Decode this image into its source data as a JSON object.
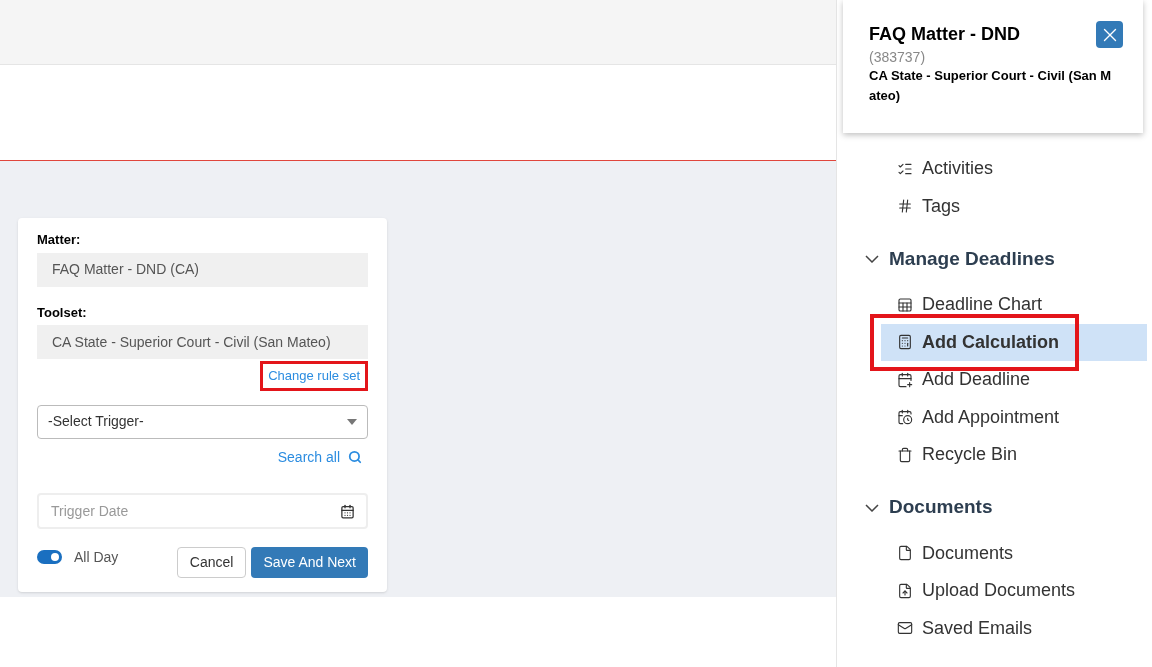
{
  "form": {
    "matter": {
      "label": "Matter:",
      "value": "FAQ Matter - DND (CA)"
    },
    "toolset": {
      "label": "Toolset:",
      "value": "CA State - Superior Court - Civil (San Mateo)"
    },
    "change_link": {
      "label": "Change rule set",
      "annotated": true
    },
    "trigger_select": {
      "placeholder": "-Select Trigger-"
    },
    "search_all": {
      "label": "Search all"
    },
    "trigger_date": {
      "placeholder": "Trigger Date"
    },
    "all_day": {
      "label": "All Day",
      "on": true
    },
    "buttons": [
      {
        "label": "Cancel",
        "kind": "secondary"
      },
      {
        "label": "Save And Next",
        "kind": "primary"
      }
    ]
  },
  "sidebar": {
    "sections": [
      {
        "items": [
          {
            "label": "Activities",
            "kind": "activities",
            "selected": false,
            "annotated": false
          },
          {
            "label": "Tags",
            "kind": "tags",
            "selected": false,
            "annotated": false
          }
        ]
      },
      {
        "title": "Manage Deadlines",
        "expanded": true,
        "items": [
          {
            "label": "Deadline Chart",
            "kind": "chart",
            "selected": false,
            "annotated": false
          },
          {
            "label": "Add Calculation",
            "kind": "calculator",
            "selected": true,
            "annotated": true
          },
          {
            "label": "Add Deadline",
            "kind": "deadline",
            "selected": false,
            "annotated": false
          },
          {
            "label": "Add Appointment",
            "kind": "appointment",
            "selected": false,
            "annotated": false
          },
          {
            "label": "Recycle Bin",
            "kind": "bin",
            "selected": false,
            "annotated": false
          }
        ]
      },
      {
        "title": "Documents",
        "expanded": true,
        "items": [
          {
            "label": "Documents",
            "kind": "file",
            "selected": false,
            "annotated": false
          },
          {
            "label": "Upload Documents",
            "kind": "upload",
            "selected": false,
            "annotated": false
          },
          {
            "label": "Saved Emails",
            "kind": "mail",
            "selected": false,
            "annotated": false
          }
        ]
      }
    ]
  },
  "popup": {
    "title": "FAQ Matter - DND",
    "number": "(383737)",
    "court": "CA State - Superior Court - Civil (San Mateo)"
  }
}
